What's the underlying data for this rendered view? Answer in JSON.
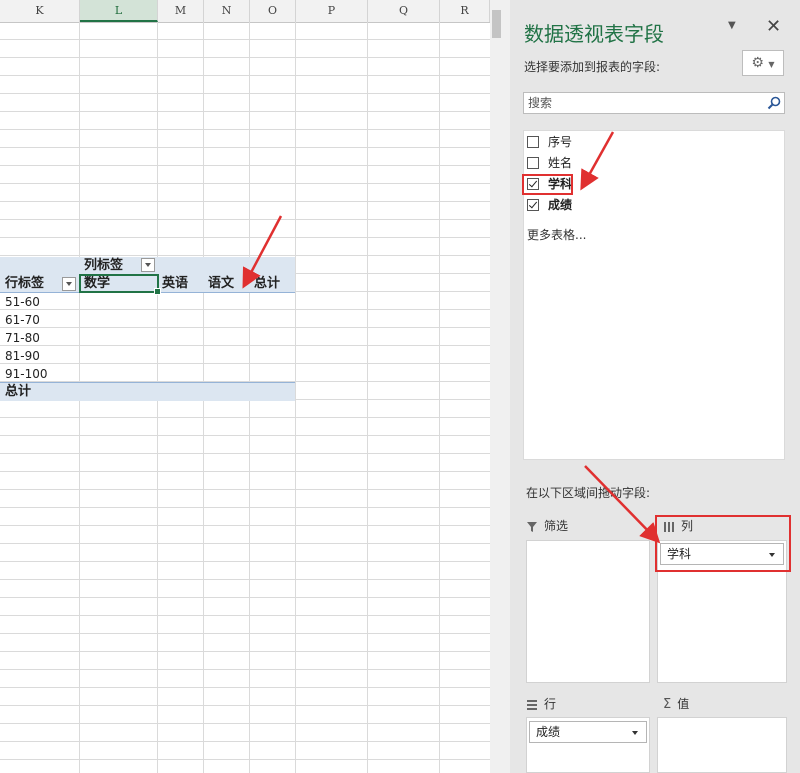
{
  "sheet": {
    "columns": [
      "K",
      "L",
      "M",
      "N",
      "O",
      "P",
      "Q",
      "R"
    ],
    "pivot": {
      "col_labels_caption": "列标签",
      "row_labels_caption": "行标签",
      "column_headers": [
        "数学",
        "英语",
        "语文",
        "总计"
      ],
      "rows": [
        "51-60",
        "61-70",
        "71-80",
        "81-90",
        "91-100"
      ],
      "grand_total": "总计"
    }
  },
  "pane": {
    "title": "数据透视表字段",
    "subtitle": "选择要添加到报表的字段:",
    "search": {
      "placeholder": "搜索"
    },
    "fields": [
      {
        "label": "序号",
        "checked": false,
        "bold": false
      },
      {
        "label": "姓名",
        "checked": false,
        "bold": false
      },
      {
        "label": "学科",
        "checked": true,
        "bold": true
      },
      {
        "label": "成绩",
        "checked": true,
        "bold": true
      }
    ],
    "more_tables": "更多表格...",
    "areas_label": "在以下区域间拖动字段:",
    "areas": {
      "filters": {
        "label": "筛选",
        "items": []
      },
      "columns": {
        "label": "列",
        "items": [
          "学科"
        ]
      },
      "rows": {
        "label": "行",
        "items": [
          "成绩"
        ]
      },
      "values": {
        "label": "值",
        "items": []
      }
    }
  },
  "colors": {
    "accent": "#217346",
    "highlight": "#e03030",
    "pivot_band": "#dce6f1"
  },
  "icons": [
    "dropdown-arrow-icon",
    "close-icon",
    "gear-icon",
    "search-icon",
    "filter-icon",
    "columns-icon",
    "rows-icon",
    "sigma-icon",
    "annotation-arrow-icon"
  ]
}
